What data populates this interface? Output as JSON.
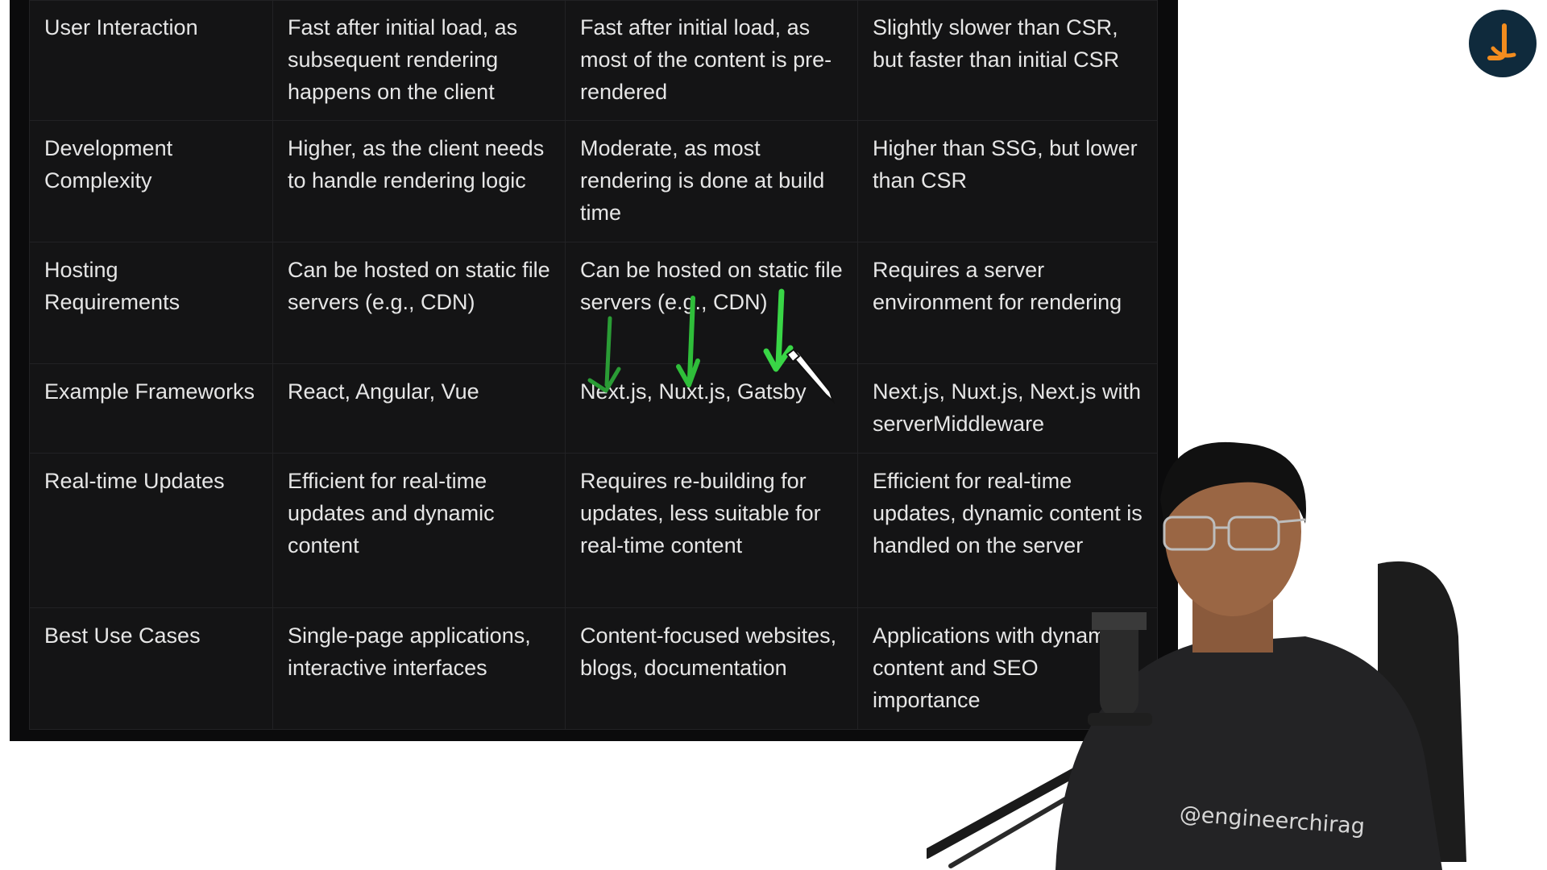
{
  "table": {
    "rows": [
      {
        "feature": "User Interaction",
        "csr": "Fast after initial load, as subsequent rendering happens on the client",
        "ssg": "Fast after initial load, as most of the content is pre-rendered",
        "ssr": "Slightly slower than CSR, but faster than initial CSR"
      },
      {
        "feature": "Development Complexity",
        "csr": "Higher, as the client needs to handle rendering logic",
        "ssg": "Moderate, as most rendering is done at build time",
        "ssr": "Higher than SSG, but lower than CSR"
      },
      {
        "feature": "Hosting Requirements",
        "csr": "Can be hosted on static file servers (e.g., CDN)",
        "ssg": "Can be hosted on static file servers (e.g., CDN)",
        "ssr": "Requires a server environment for rendering"
      },
      {
        "feature": "Example Frameworks",
        "csr": "React, Angular, Vue",
        "ssg": "Next.js, Nuxt.js, Gatsby",
        "ssr": "Next.js, Nuxt.js, Next.js with serverMiddleware"
      },
      {
        "feature": "Real-time Updates",
        "csr": "Efficient for real-time updates and dynamic content",
        "ssg": "Requires re-building for updates, less suitable for real-time content",
        "ssr": "Efficient for real-time updates, dynamic content is handled on the server"
      },
      {
        "feature": "Best Use Cases",
        "csr": "Single-page applications, interactive interfaces",
        "ssg": "Content-focused websites, blogs, documentation",
        "ssr": "Applications with dynamic content and SEO importance"
      }
    ]
  },
  "overlay": {
    "handle": "@engineerchirag"
  },
  "colors": {
    "panel_bg": "#0b0b0c",
    "cell_bg": "#141415",
    "text": "#e6e6e6",
    "annotation_green": "#2ecc40",
    "logo_bg": "#0f2a3c",
    "logo_accent": "#f28c1e"
  },
  "icons": {
    "annotation": "green-arrow-icon",
    "cursor": "pen-cursor-icon",
    "logo": "channel-logo-icon"
  }
}
